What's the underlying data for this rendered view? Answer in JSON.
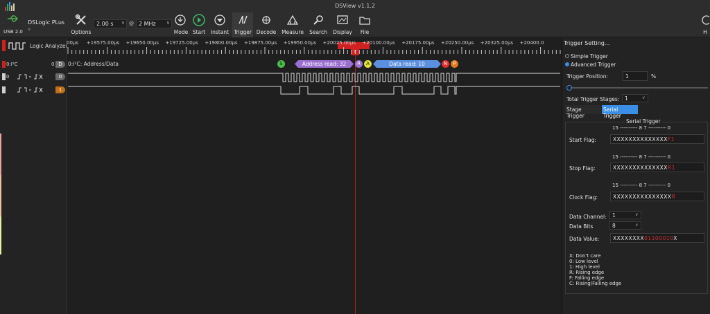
{
  "window": {
    "title": "DSView v1.1.2"
  },
  "toolbar": {
    "device_label": "USB 2.0",
    "device_name": "DSLogic PLus",
    "options_label": "Options",
    "duration": "2.00 s",
    "rate_prefix": "@",
    "samplerate": "2 MHz",
    "mode_label": "Mode",
    "start_label": "Start",
    "instant_label": "Instant",
    "trigger_label": "Trigger",
    "decode_label": "Decode",
    "measure_label": "Measure",
    "search_label": "Search",
    "display_label": "Display",
    "file_label": "File",
    "help_label": "H"
  },
  "channels": {
    "logic_analyzer_label": "Logic Analyzer",
    "decoder_left": "0:I²C",
    "decoder_index": "0",
    "decoder_badge": "D",
    "decoder_title": "0:I²C: Address/Data",
    "ch0_label": "0",
    "ch0_badge": "0",
    "ch1_badge": "1"
  },
  "ruler": {
    "labels": [
      "00µs",
      "+19575.00µs",
      "+19650.00µs",
      "+19725.00µs",
      "+19800.00µs",
      "+19875.00µs",
      "+19950.00µs",
      "+20025.00µs",
      "+20100.00µs",
      "+20175.00µs",
      "+20250.00µs",
      "+20325.00µs",
      "+20400.0"
    ],
    "trigger_marker": "T"
  },
  "decode": {
    "start": "S",
    "address": "Address read: 32",
    "read": "R",
    "ack": "A",
    "data": "Data read: 10",
    "nack": "N",
    "stop": "P"
  },
  "trigger_panel": {
    "title": "Trigger Setting...",
    "simple": "Simple Trigger",
    "advanced": "Advanced Trigger",
    "position_label": "Trigger Position:",
    "position_value": "1",
    "position_unit": "%",
    "position_fraction": 0.01,
    "stages_label": "Total Trigger Stages:",
    "stages_value": "1",
    "tab_stage": "Stage Trigger",
    "tab_serial": "Serial Trigger",
    "group_title": "Serial Trigger",
    "bit_header": "15 ---------- 8 7 ---------- 0",
    "start_flag_label": "Start Flag:",
    "start_flag_x": "XXXXXXXXXXXXXX",
    "start_flag_sel": "F1",
    "stop_flag_label": "Stop Flag:",
    "stop_flag_x": "XXXXXXXXXXXXXX",
    "stop_flag_sel": "R1",
    "clock_flag_label": "Clock Flag:",
    "clock_flag_x": "XXXXXXXXXXXXXXX",
    "clock_flag_sel": "R",
    "data_channel_label": "Data Channel:",
    "data_channel_value": "1",
    "data_bits_label": "Data Bits",
    "data_bits_value": "8",
    "data_value_label": "Data Value:",
    "data_value_x": "XXXXXXXX",
    "data_value_bits": "01100010",
    "data_value_tail": "X",
    "legend": [
      "X: Don't care",
      "0: Low level",
      "1: High level",
      "R: Rising edge",
      "F: Falling edge",
      "C: Rising/Falling edge"
    ]
  },
  "colors": {
    "accent": "#3a8ee6",
    "trigger_red": "#d02020",
    "address_purple": "#9a6fd0",
    "data_blue": "#5b8fe0",
    "start_green": "#4bbf4b",
    "stop_orange": "#e07a20"
  }
}
